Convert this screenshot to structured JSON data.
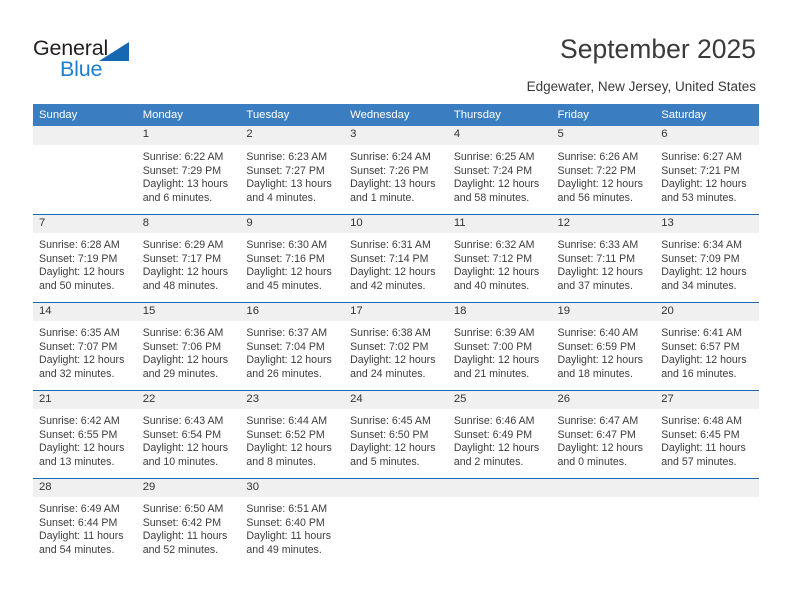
{
  "brand": {
    "word_one": "General",
    "word_two": "Blue",
    "triangle_color": "#1668b3",
    "word_two_color": "#1b7fd4"
  },
  "header": {
    "title": "September 2025",
    "subtitle": "Edgewater, New Jersey, United States"
  },
  "calendar": {
    "header_bg": "#3a7ec1",
    "daynum_bg": "#f0f0f0",
    "row_rule_color": "#1668b3",
    "weekday_headers": [
      "Sunday",
      "Monday",
      "Tuesday",
      "Wednesday",
      "Thursday",
      "Friday",
      "Saturday"
    ],
    "weeks": [
      [
        {
          "day": "",
          "empty": true,
          "sunrise": "",
          "sunset": "",
          "daylight_line1": "",
          "daylight_line2": ""
        },
        {
          "day": "1",
          "empty": false,
          "sunrise": "Sunrise: 6:22 AM",
          "sunset": "Sunset: 7:29 PM",
          "daylight_line1": "Daylight: 13 hours",
          "daylight_line2": "and 6 minutes."
        },
        {
          "day": "2",
          "empty": false,
          "sunrise": "Sunrise: 6:23 AM",
          "sunset": "Sunset: 7:27 PM",
          "daylight_line1": "Daylight: 13 hours",
          "daylight_line2": "and 4 minutes."
        },
        {
          "day": "3",
          "empty": false,
          "sunrise": "Sunrise: 6:24 AM",
          "sunset": "Sunset: 7:26 PM",
          "daylight_line1": "Daylight: 13 hours",
          "daylight_line2": "and 1 minute."
        },
        {
          "day": "4",
          "empty": false,
          "sunrise": "Sunrise: 6:25 AM",
          "sunset": "Sunset: 7:24 PM",
          "daylight_line1": "Daylight: 12 hours",
          "daylight_line2": "and 58 minutes."
        },
        {
          "day": "5",
          "empty": false,
          "sunrise": "Sunrise: 6:26 AM",
          "sunset": "Sunset: 7:22 PM",
          "daylight_line1": "Daylight: 12 hours",
          "daylight_line2": "and 56 minutes."
        },
        {
          "day": "6",
          "empty": false,
          "sunrise": "Sunrise: 6:27 AM",
          "sunset": "Sunset: 7:21 PM",
          "daylight_line1": "Daylight: 12 hours",
          "daylight_line2": "and 53 minutes."
        }
      ],
      [
        {
          "day": "7",
          "empty": false,
          "sunrise": "Sunrise: 6:28 AM",
          "sunset": "Sunset: 7:19 PM",
          "daylight_line1": "Daylight: 12 hours",
          "daylight_line2": "and 50 minutes."
        },
        {
          "day": "8",
          "empty": false,
          "sunrise": "Sunrise: 6:29 AM",
          "sunset": "Sunset: 7:17 PM",
          "daylight_line1": "Daylight: 12 hours",
          "daylight_line2": "and 48 minutes."
        },
        {
          "day": "9",
          "empty": false,
          "sunrise": "Sunrise: 6:30 AM",
          "sunset": "Sunset: 7:16 PM",
          "daylight_line1": "Daylight: 12 hours",
          "daylight_line2": "and 45 minutes."
        },
        {
          "day": "10",
          "empty": false,
          "sunrise": "Sunrise: 6:31 AM",
          "sunset": "Sunset: 7:14 PM",
          "daylight_line1": "Daylight: 12 hours",
          "daylight_line2": "and 42 minutes."
        },
        {
          "day": "11",
          "empty": false,
          "sunrise": "Sunrise: 6:32 AM",
          "sunset": "Sunset: 7:12 PM",
          "daylight_line1": "Daylight: 12 hours",
          "daylight_line2": "and 40 minutes."
        },
        {
          "day": "12",
          "empty": false,
          "sunrise": "Sunrise: 6:33 AM",
          "sunset": "Sunset: 7:11 PM",
          "daylight_line1": "Daylight: 12 hours",
          "daylight_line2": "and 37 minutes."
        },
        {
          "day": "13",
          "empty": false,
          "sunrise": "Sunrise: 6:34 AM",
          "sunset": "Sunset: 7:09 PM",
          "daylight_line1": "Daylight: 12 hours",
          "daylight_line2": "and 34 minutes."
        }
      ],
      [
        {
          "day": "14",
          "empty": false,
          "sunrise": "Sunrise: 6:35 AM",
          "sunset": "Sunset: 7:07 PM",
          "daylight_line1": "Daylight: 12 hours",
          "daylight_line2": "and 32 minutes."
        },
        {
          "day": "15",
          "empty": false,
          "sunrise": "Sunrise: 6:36 AM",
          "sunset": "Sunset: 7:06 PM",
          "daylight_line1": "Daylight: 12 hours",
          "daylight_line2": "and 29 minutes."
        },
        {
          "day": "16",
          "empty": false,
          "sunrise": "Sunrise: 6:37 AM",
          "sunset": "Sunset: 7:04 PM",
          "daylight_line1": "Daylight: 12 hours",
          "daylight_line2": "and 26 minutes."
        },
        {
          "day": "17",
          "empty": false,
          "sunrise": "Sunrise: 6:38 AM",
          "sunset": "Sunset: 7:02 PM",
          "daylight_line1": "Daylight: 12 hours",
          "daylight_line2": "and 24 minutes."
        },
        {
          "day": "18",
          "empty": false,
          "sunrise": "Sunrise: 6:39 AM",
          "sunset": "Sunset: 7:00 PM",
          "daylight_line1": "Daylight: 12 hours",
          "daylight_line2": "and 21 minutes."
        },
        {
          "day": "19",
          "empty": false,
          "sunrise": "Sunrise: 6:40 AM",
          "sunset": "Sunset: 6:59 PM",
          "daylight_line1": "Daylight: 12 hours",
          "daylight_line2": "and 18 minutes."
        },
        {
          "day": "20",
          "empty": false,
          "sunrise": "Sunrise: 6:41 AM",
          "sunset": "Sunset: 6:57 PM",
          "daylight_line1": "Daylight: 12 hours",
          "daylight_line2": "and 16 minutes."
        }
      ],
      [
        {
          "day": "21",
          "empty": false,
          "sunrise": "Sunrise: 6:42 AM",
          "sunset": "Sunset: 6:55 PM",
          "daylight_line1": "Daylight: 12 hours",
          "daylight_line2": "and 13 minutes."
        },
        {
          "day": "22",
          "empty": false,
          "sunrise": "Sunrise: 6:43 AM",
          "sunset": "Sunset: 6:54 PM",
          "daylight_line1": "Daylight: 12 hours",
          "daylight_line2": "and 10 minutes."
        },
        {
          "day": "23",
          "empty": false,
          "sunrise": "Sunrise: 6:44 AM",
          "sunset": "Sunset: 6:52 PM",
          "daylight_line1": "Daylight: 12 hours",
          "daylight_line2": "and 8 minutes."
        },
        {
          "day": "24",
          "empty": false,
          "sunrise": "Sunrise: 6:45 AM",
          "sunset": "Sunset: 6:50 PM",
          "daylight_line1": "Daylight: 12 hours",
          "daylight_line2": "and 5 minutes."
        },
        {
          "day": "25",
          "empty": false,
          "sunrise": "Sunrise: 6:46 AM",
          "sunset": "Sunset: 6:49 PM",
          "daylight_line1": "Daylight: 12 hours",
          "daylight_line2": "and 2 minutes."
        },
        {
          "day": "26",
          "empty": false,
          "sunrise": "Sunrise: 6:47 AM",
          "sunset": "Sunset: 6:47 PM",
          "daylight_line1": "Daylight: 12 hours",
          "daylight_line2": "and 0 minutes."
        },
        {
          "day": "27",
          "empty": false,
          "sunrise": "Sunrise: 6:48 AM",
          "sunset": "Sunset: 6:45 PM",
          "daylight_line1": "Daylight: 11 hours",
          "daylight_line2": "and 57 minutes."
        }
      ],
      [
        {
          "day": "28",
          "empty": false,
          "sunrise": "Sunrise: 6:49 AM",
          "sunset": "Sunset: 6:44 PM",
          "daylight_line1": "Daylight: 11 hours",
          "daylight_line2": "and 54 minutes."
        },
        {
          "day": "29",
          "empty": false,
          "sunrise": "Sunrise: 6:50 AM",
          "sunset": "Sunset: 6:42 PM",
          "daylight_line1": "Daylight: 11 hours",
          "daylight_line2": "and 52 minutes."
        },
        {
          "day": "30",
          "empty": false,
          "sunrise": "Sunrise: 6:51 AM",
          "sunset": "Sunset: 6:40 PM",
          "daylight_line1": "Daylight: 11 hours",
          "daylight_line2": "and 49 minutes."
        },
        {
          "day": "",
          "empty": true,
          "sunrise": "",
          "sunset": "",
          "daylight_line1": "",
          "daylight_line2": ""
        },
        {
          "day": "",
          "empty": true,
          "sunrise": "",
          "sunset": "",
          "daylight_line1": "",
          "daylight_line2": ""
        },
        {
          "day": "",
          "empty": true,
          "sunrise": "",
          "sunset": "",
          "daylight_line1": "",
          "daylight_line2": ""
        },
        {
          "day": "",
          "empty": true,
          "sunrise": "",
          "sunset": "",
          "daylight_line1": "",
          "daylight_line2": ""
        }
      ]
    ]
  }
}
